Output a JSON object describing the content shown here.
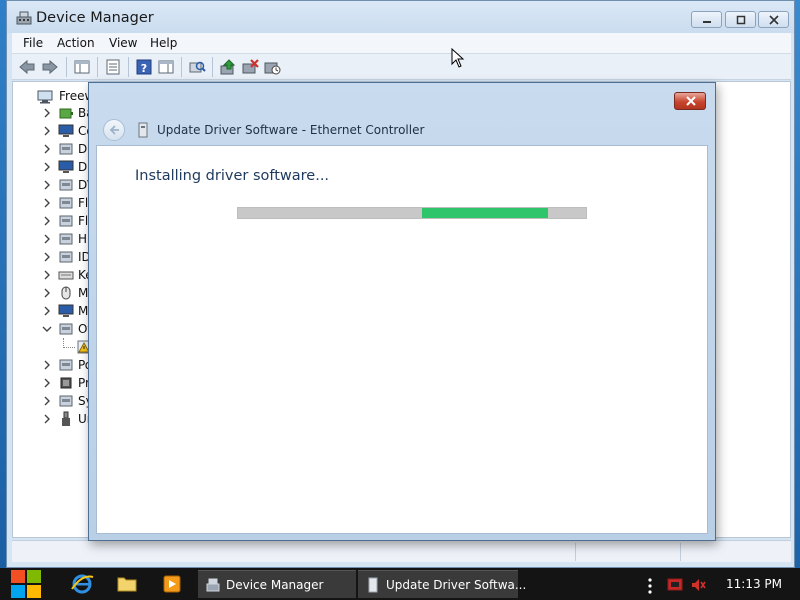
{
  "window": {
    "title": "Device Manager",
    "menu": [
      "File",
      "Action",
      "View",
      "Help"
    ]
  },
  "tree": {
    "root_label": "Freew",
    "items": [
      {
        "label": "Ba",
        "icon": "battery-icon"
      },
      {
        "label": "Co",
        "icon": "computer-icon"
      },
      {
        "label": "Di",
        "icon": "disk-drive-icon"
      },
      {
        "label": "Di",
        "icon": "display-adapter-icon"
      },
      {
        "label": "DV",
        "icon": "dvd-drive-icon"
      },
      {
        "label": "Fl",
        "icon": "floppy-icon"
      },
      {
        "label": "Fl",
        "icon": "floppy-controller-icon"
      },
      {
        "label": "Hu",
        "icon": "hid-icon"
      },
      {
        "label": "ID",
        "icon": "ide-controller-icon"
      },
      {
        "label": "Ke",
        "icon": "keyboard-icon"
      },
      {
        "label": "Mi",
        "icon": "mouse-icon"
      },
      {
        "label": "Mo",
        "icon": "monitor-icon"
      },
      {
        "label": "Ot",
        "icon": "other-devices-icon"
      },
      {
        "label": "",
        "icon": "warning-device-icon"
      },
      {
        "label": "Po",
        "icon": "ports-icon"
      },
      {
        "label": "Pr",
        "icon": "processor-icon"
      },
      {
        "label": "Sy",
        "icon": "system-devices-icon"
      },
      {
        "label": "Ur",
        "icon": "usb-icon"
      }
    ]
  },
  "dialog": {
    "title": "Update Driver Software - Ethernet Controller",
    "heading": "Installing driver software...",
    "progress": {
      "segment_start_fraction": 0.53,
      "segment_end_fraction": 0.89
    }
  },
  "taskbar": {
    "tasks": [
      {
        "label": "Device Manager"
      },
      {
        "label": "Update Driver Softwa..."
      }
    ],
    "clock": "11:13 PM"
  },
  "colors": {
    "progress_fill": "#2fc56a",
    "progress_track": "#c8c8c8",
    "close_button": "#c8452e",
    "taskbar": "#141414"
  }
}
